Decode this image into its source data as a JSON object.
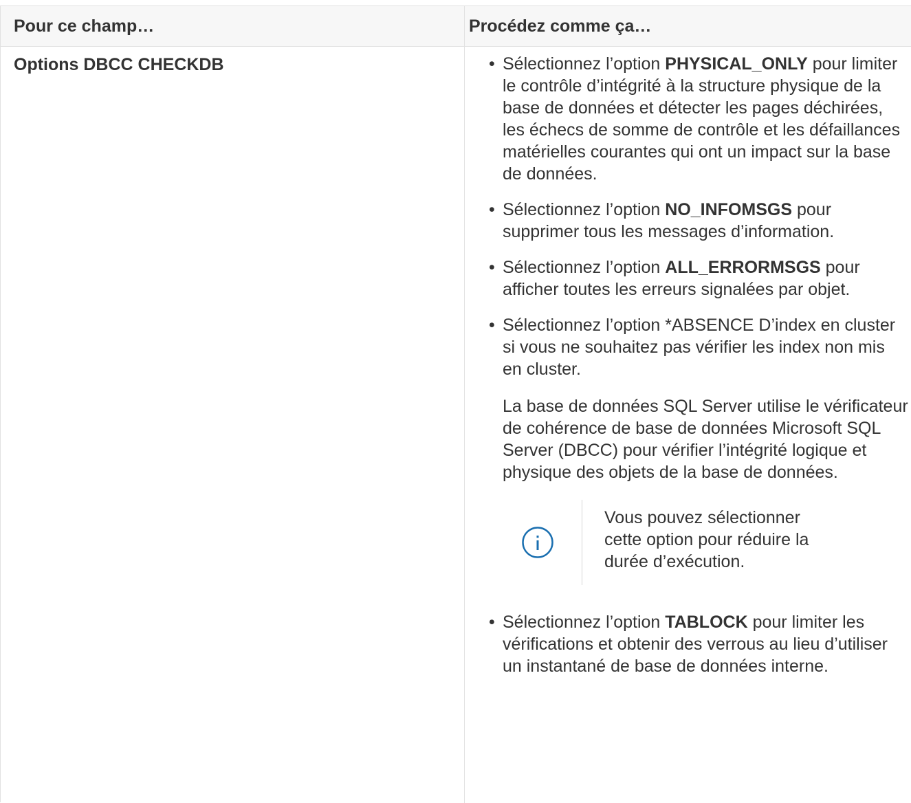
{
  "table": {
    "headers": [
      "Pour ce champ…",
      "Procédez comme ça…"
    ],
    "field_name": "Options DBCC CHECKDB",
    "options": [
      {
        "prefix": "Sélectionnez l’option ",
        "keyword": "PHYSICAL_ONLY",
        "suffix": " pour limiter le contrôle d’intégrité à la structure physique de la base de données et détecter les pages déchirées, les échecs de somme de contrôle et les défaillances matérielles courantes qui ont un impact sur la base de données."
      },
      {
        "prefix": "Sélectionnez l’option ",
        "keyword": "NO_INFOMSGS",
        "suffix": " pour supprimer tous les messages d’information."
      },
      {
        "prefix": "Sélectionnez l’option ",
        "keyword": "ALL_ERRORMSGS",
        "suffix": " pour afficher toutes les erreurs signalées par objet."
      },
      {
        "text": "Sélectionnez l’option *ABSENCE D’index en cluster si vous ne souhaitez pas vérifier les index non mis en cluster.",
        "paragraph": "La base de données SQL Server utilise le vérificateur de cohérence de base de données Microsoft SQL Server (DBCC) pour vérifier l’intégrité logique et physique des objets de la base de données.",
        "note": {
          "icon": "info-icon",
          "text": "Vous pouvez sélectionner cette option pour réduire la durée d’exécution."
        }
      },
      {
        "prefix": "Sélectionnez l’option ",
        "keyword": "TABLOCK",
        "suffix": " pour limiter les vérifications et obtenir des verrous au lieu d’utiliser un instantané de base de données interne."
      }
    ]
  },
  "colors": {
    "text": "#333333",
    "header_bg": "#f7f7f7",
    "border": "#e1e1e1",
    "icon": "#1a6fb0"
  }
}
